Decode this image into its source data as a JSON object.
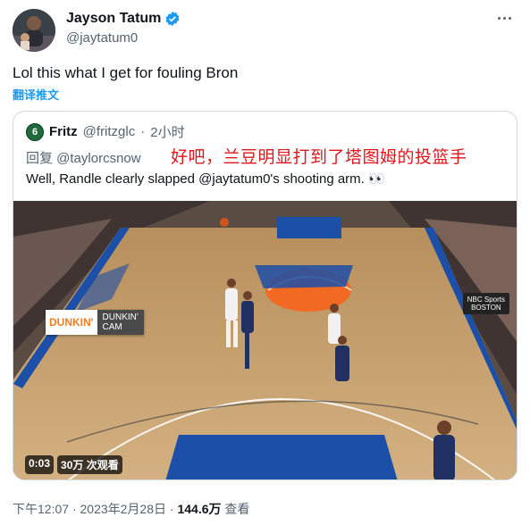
{
  "author": {
    "name": "Jayson Tatum",
    "handle": "@jaytatum0"
  },
  "tweet": {
    "text": "Lol this what I get for fouling Bron",
    "translate_label": "翻译推文"
  },
  "quoted": {
    "avatar_letter": "6",
    "name": "Fritz",
    "handle": "@fritzglc",
    "separator": "·",
    "time": "2小时",
    "reply_to": "回复 @taylorcsnow",
    "overlay_caption": "好吧，兰豆明显打到了塔图姆的投篮手",
    "text": "Well, Randle clearly slapped @jaytatum0's shooting arm. 👀",
    "video": {
      "brand_word": "DUNKIN'",
      "brand_line1": "DUNKIN'",
      "brand_line2": "CAM",
      "network_line1": "NBC Sports",
      "network_line2": "BOSTON",
      "duration": "0:03",
      "views": "30万 次观看"
    }
  },
  "meta": {
    "time": "下午12:07",
    "sep1": "·",
    "date": "2023年2月28日",
    "sep2": "·",
    "views_count": "144.6万",
    "views_label": "查看"
  },
  "colors": {
    "verified": "#1d9bf0",
    "link": "#1d9bf0",
    "overlay_caption": "#e0161b",
    "court_blue": "#1b4fa8",
    "knicks_orange": "#f26a21"
  }
}
